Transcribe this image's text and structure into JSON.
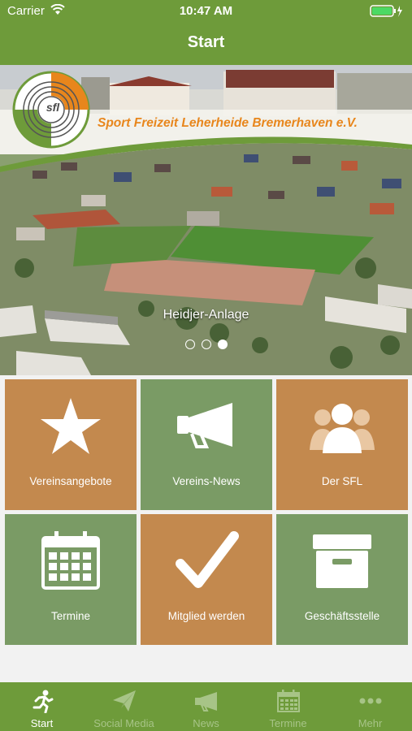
{
  "status_bar": {
    "carrier": "Carrier",
    "time": "10:47 AM"
  },
  "nav": {
    "title": "Start"
  },
  "hero": {
    "club_name": "Sport Freizeit Leherheide Bremerhaven e.V.",
    "logo_text": "sfl",
    "caption": "Heidjer-Anlage",
    "page_count": 3,
    "active_page": 3
  },
  "tiles": [
    {
      "label": "Vereinsangebote",
      "icon": "star-icon",
      "color": "#c3894e"
    },
    {
      "label": "Vereins-News",
      "icon": "megaphone-icon",
      "color": "#7a9b65"
    },
    {
      "label": "Der SFL",
      "icon": "group-icon",
      "color": "#c3894e"
    },
    {
      "label": "Termine",
      "icon": "calendar-icon",
      "color": "#7a9b65"
    },
    {
      "label": "Mitglied werden",
      "icon": "checkmark-icon",
      "color": "#c3894e"
    },
    {
      "label": "Geschäftsstelle",
      "icon": "archive-box-icon",
      "color": "#7a9b65"
    }
  ],
  "tab_bar": {
    "items": [
      {
        "label": "Start",
        "icon": "runner-icon",
        "active": true
      },
      {
        "label": "Social Media",
        "icon": "paper-plane-icon",
        "active": false
      },
      {
        "label": "News",
        "icon": "megaphone-icon",
        "active": false
      },
      {
        "label": "Termine",
        "icon": "calendar-icon",
        "active": false
      },
      {
        "label": "Mehr",
        "icon": "more-dots-icon",
        "active": false
      }
    ]
  },
  "colors": {
    "brand_green": "#6e9b3a",
    "tile_orange": "#c3894e",
    "tile_green": "#7a9b65",
    "club_orange": "#e8861c"
  }
}
